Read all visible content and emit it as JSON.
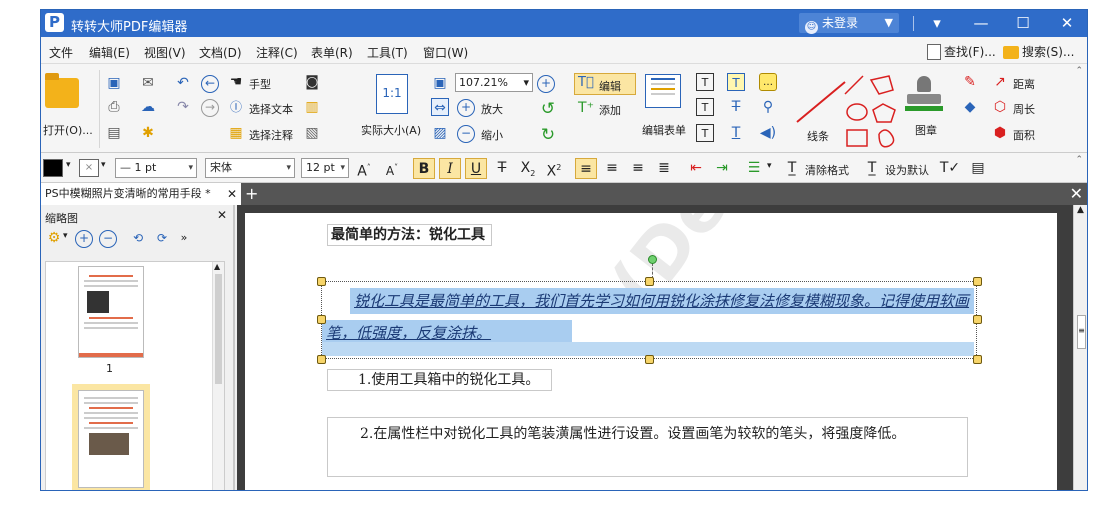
{
  "app": {
    "title": "转转大师PDF编辑器",
    "logo": "P",
    "login": "未登录"
  },
  "window_controls": {
    "menu": "▾",
    "minimize": "—",
    "maximize": "☐",
    "close": "✕"
  },
  "menu": [
    "文件",
    "编辑(E)",
    "视图(V)",
    "文档(D)",
    "注释(C)",
    "表单(R)",
    "工具(T)",
    "窗口(W)"
  ],
  "menu_right": {
    "find": "查找(F)...",
    "search": "搜索(S)..."
  },
  "ribbon": {
    "open": "打开(O)...",
    "hand": "手型",
    "select_text": "选择文本",
    "select_annot": "选择注释",
    "actual_size": "实际大小(A)",
    "actual_size_icon": "1:1",
    "zoom": "107.21%",
    "zoom_in": "放大",
    "zoom_out": "缩小",
    "edit": "编辑",
    "add": "添加",
    "edit_form": "编辑表单",
    "line": "线条",
    "stamp": "图章",
    "distance": "距离",
    "perimeter": "周长",
    "area": "面积"
  },
  "format": {
    "stroke_width": "1 pt",
    "font": "宋体",
    "font_size": "12 pt",
    "clear_format": "清除格式",
    "set_default": "设为默认"
  },
  "tab": {
    "label": "PS中模糊照片变清晰的常用手段 *",
    "close": "✕",
    "add": "+"
  },
  "thumbs": {
    "title": "缩略图",
    "close": "✕",
    "page1": "1"
  },
  "document": {
    "heading": "最简单的方法：锐化工具",
    "para1": "锐化工具是最简单的工具，我们首先学习如何用锐化涂抹修复法修复模糊现象。记得使用软画笔，低强度，反复涂抹。",
    "step1": "1.使用工具箱中的锐化工具。",
    "step2": "2.在属性栏中对锐化工具的笔装潢属性进行设置。设置画笔为较软的笔头，将强度降低。",
    "watermark": "(Demo Vers"
  },
  "colors": {
    "titlebar": "#2f6cc9",
    "highlight": "#a9cdf0",
    "accent_red": "#e26c4a"
  }
}
